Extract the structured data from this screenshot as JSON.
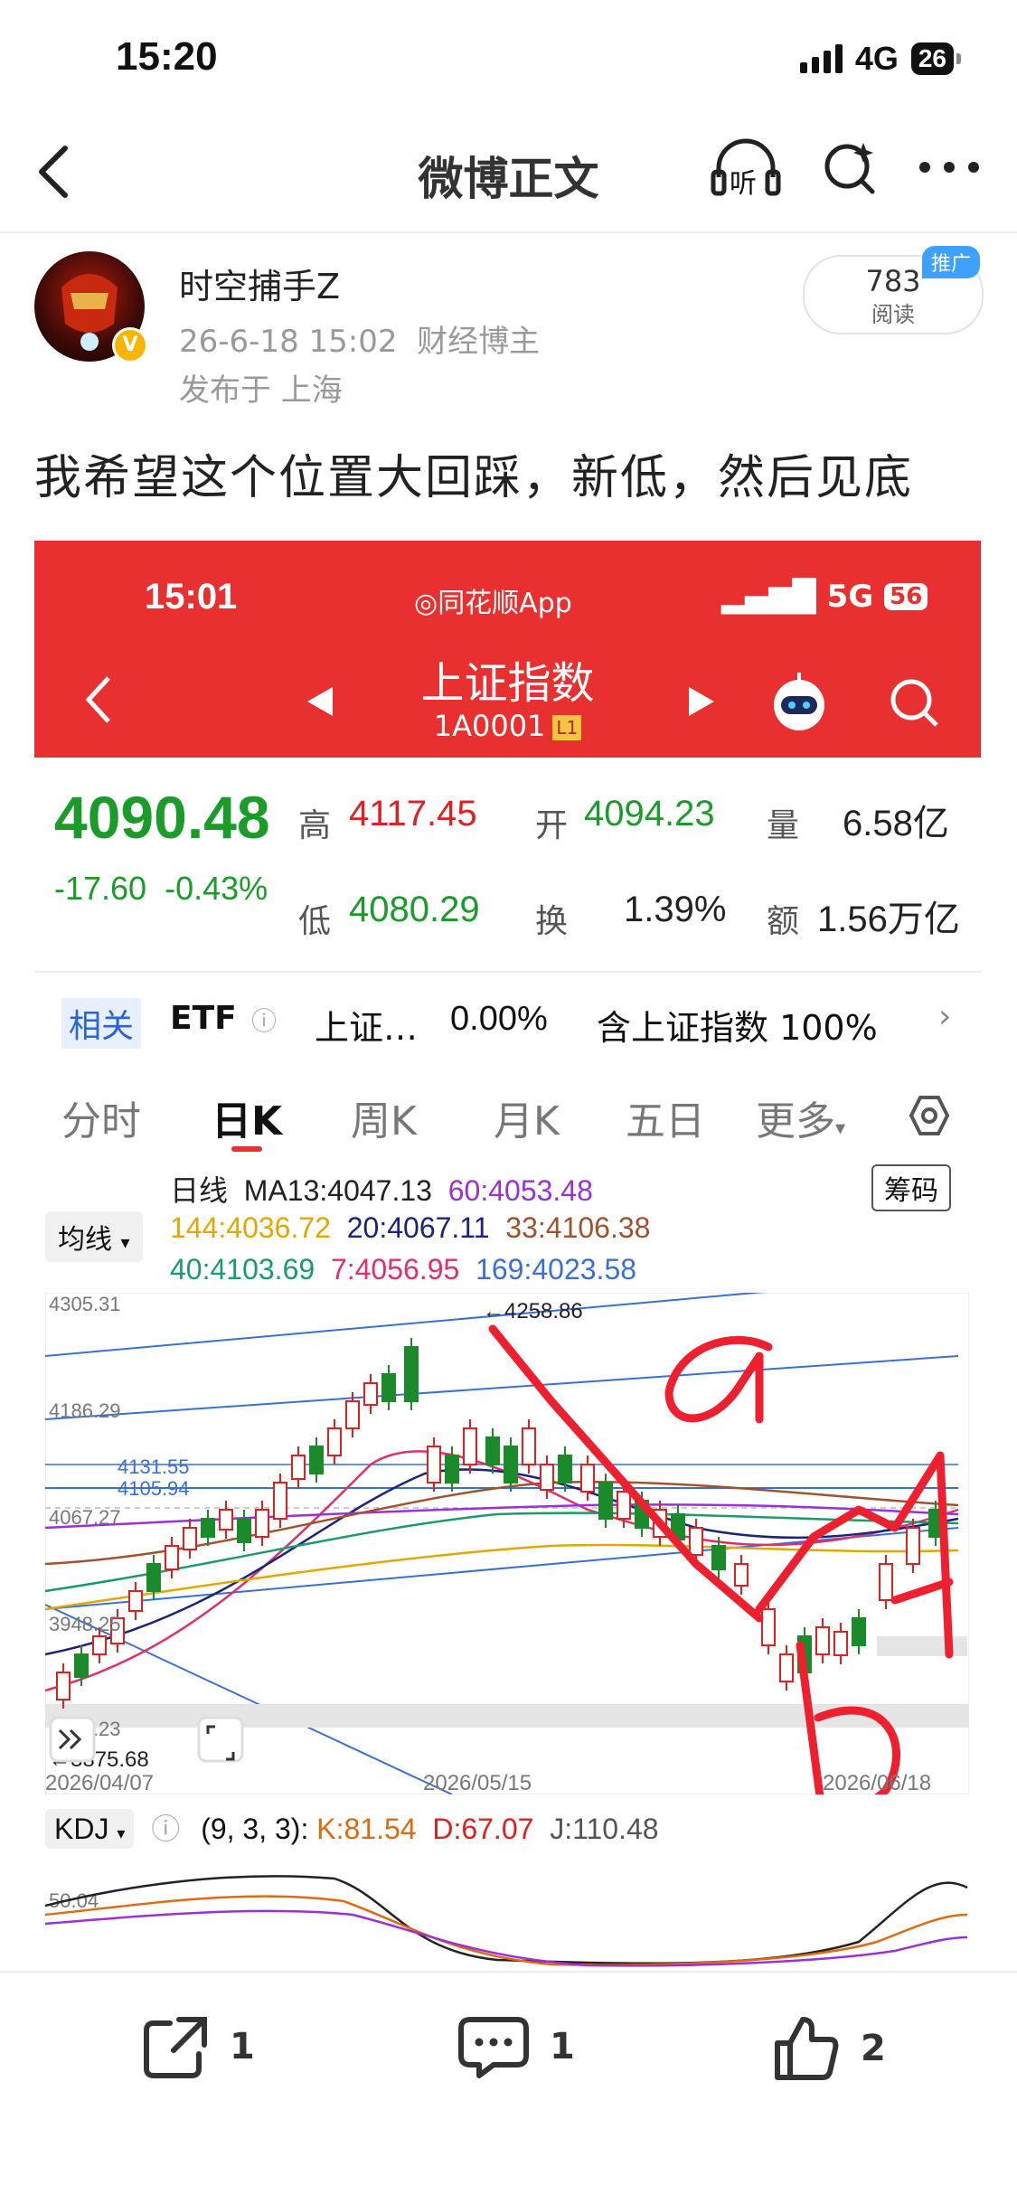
{
  "status": {
    "time": "15:20",
    "network": "4G",
    "battery": "26"
  },
  "nav": {
    "title": "微博正文",
    "listen_label": "听"
  },
  "author": {
    "name": "时空捕手Z",
    "time": "26-6-18 15:02",
    "tag": "财经博主",
    "location": "发布于 上海",
    "reads_count": "783",
    "reads_label": "阅读",
    "ad_badge": "推广"
  },
  "post": {
    "text": "我希望这个位置大回踩，新低，然后见底"
  },
  "shot": {
    "status": {
      "time": "15:01",
      "app": "同花顺App",
      "network": "5G",
      "battery": "56"
    },
    "header": {
      "title": "上证指数",
      "code": "1A0001",
      "badge": "L1"
    },
    "quote": {
      "price": "4090.48",
      "change": "-17.60",
      "change_pct": "-0.43%",
      "high_label": "高",
      "high": "4117.45",
      "low_label": "低",
      "low": "4080.29",
      "open_label": "开",
      "open": "4094.23",
      "turnover_label": "换",
      "turnover": "1.39%",
      "volume_label": "量",
      "volume": "6.58亿",
      "amount_label": "额",
      "amount": "1.56万亿"
    },
    "etf": {
      "tag": "相关",
      "label": "ETF",
      "name": "上证…",
      "pct": "0.00%",
      "contains": "含上证指数 100%"
    },
    "tabs": [
      "分时",
      "日K",
      "周K",
      "月K",
      "五日",
      "更多"
    ],
    "active_tab": "日K",
    "chips_label": "筹码",
    "ma_selector": "均线",
    "ma_line1": [
      "日线",
      "MA13:4047.13",
      "60:4053.48"
    ],
    "ma_line2": [
      "144:4036.72",
      "20:4067.11",
      "33:4106.38"
    ],
    "ma_line3": [
      "40:4103.69",
      "7:4056.95",
      "169:4023.58"
    ],
    "ma_colors": {
      "ma13": "#222222",
      "ma60": "#9b30d9",
      "ma144": "#e0a800",
      "ma20": "#1a237e",
      "ma33": "#a0522d",
      "ma40": "#1a9b6a",
      "ma7": "#e0306a",
      "ma169": "#3a6fd8"
    },
    "chart_labels": {
      "high_mark": "←4258.86",
      "low_mark": "←3875.68",
      "y1": "4305.31",
      "y2": "4186.29",
      "y3": "4131.55",
      "y4": "4105.94",
      "y5": "4067.27",
      "y6": "3948.25",
      "y7": "3829.23"
    },
    "x_dates": [
      "2026/04/07",
      "2026/05/15",
      "2026/06/18"
    ],
    "annotations": [
      "a",
      "b"
    ],
    "kdj": {
      "name": "KDJ",
      "params": "(9, 3, 3):",
      "k": "K:81.54",
      "d": "D:67.07",
      "j": "J:110.48",
      "axis": "50.04"
    }
  },
  "actions": {
    "share_count": "1",
    "comment_count": "1",
    "like_count": "2"
  },
  "colors": {
    "accent_red": "#e93030",
    "price_green": "#1a9b2a",
    "link_blue": "#2b64d8"
  }
}
